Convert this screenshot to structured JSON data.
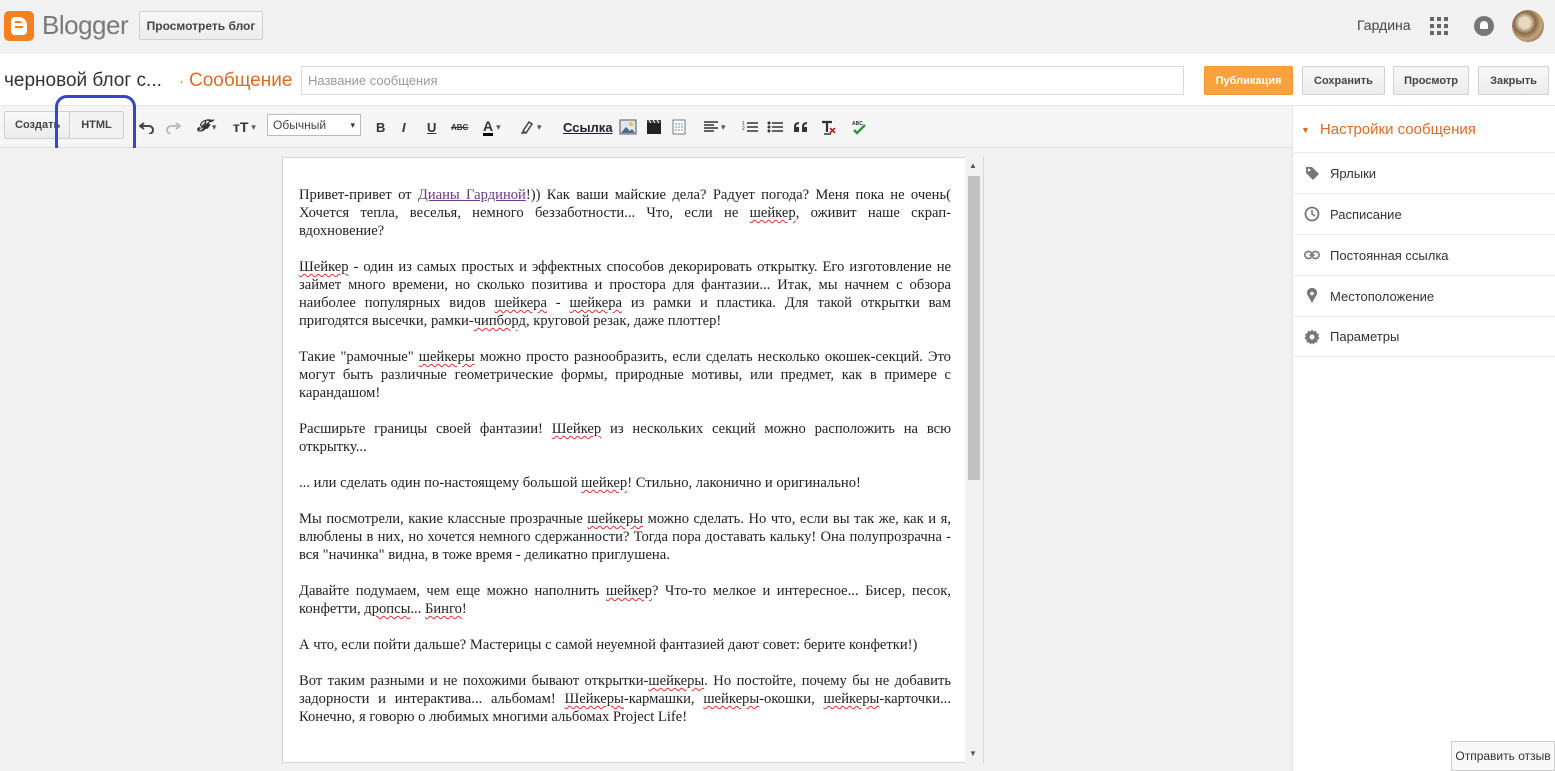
{
  "app": {
    "logo_text": "Blogger",
    "view_blog": "Просмотреть блог",
    "user_name": "Гардина"
  },
  "titlebar": {
    "blog_name": "черновой блог с...",
    "separator": "·",
    "section": "Сообщение",
    "title_placeholder": "Название сообщения",
    "publish": "Публикация",
    "save": "Сохранить",
    "preview": "Просмотр",
    "close": "Закрыть"
  },
  "toolbar": {
    "compose": "Создать",
    "html": "HTML",
    "format": "Обычный",
    "link": "Ссылка",
    "font_icon": "𝓕",
    "size_icon": "тT",
    "bold": "B",
    "italic": "I",
    "underline": "U",
    "strike": "ABC",
    "text_color": "A",
    "caret": "▾"
  },
  "sidebar": {
    "header": "Настройки сообщения",
    "items": [
      {
        "label": "Ярлыки",
        "icon": "label-icon"
      },
      {
        "label": "Расписание",
        "icon": "clock-icon"
      },
      {
        "label": "Постоянная ссылка",
        "icon": "link-icon"
      },
      {
        "label": "Местоположение",
        "icon": "location-icon"
      },
      {
        "label": "Параметры",
        "icon": "gear-icon"
      }
    ]
  },
  "feedback": "Отправить отзыв",
  "post": {
    "p1": {
      "a": "Привет-привет от ",
      "link": "Дианы Гардиной",
      "b": "!)) Как ваши майские дела? Радует погода? Меня пока не очень( Хочется тепла, веселья, немного беззаботности... Что, если не ",
      "w1": "шейкер",
      "c": ", оживит наше скрап-вдохновение?"
    },
    "p2": {
      "w1": "Шейкер",
      "a": " - один из самых простых и эффектных способов декорировать открытку. Его изготовление не займет много времени, но сколько позитива и простора для фантазии... Итак, мы начнем с обзора наиболее популярных видов ",
      "w2": "шейкера",
      "b": " - ",
      "w3": "шейкера",
      "c": " из рамки и пластика. Для такой открытки вам пригодятся высечки, рамки-",
      "w4": "чипборд",
      "d": ", круговой резак, даже плоттер!"
    },
    "p3": {
      "a": "Такие \"рамочные\" ",
      "w1": "шейкеры",
      "b": " можно просто разнообразить, если сделать несколько окошек-секций. Это могут быть различные геометрические формы, природные мотивы, или предмет, как в примере с карандашом!"
    },
    "p4": {
      "a": "Расширьте границы своей фантазии! ",
      "w1": "Шейкер",
      "b": " из нескольких секций можно расположить на всю открытку..."
    },
    "p5": {
      "a": "... или сделать один по-настоящему большой ",
      "w1": "шейкер",
      "b": "! Стильно, лаконично и оригинально!"
    },
    "p6": {
      "a": "Мы посмотрели, какие классные прозрачные ",
      "w1": "шейкеры",
      "b": " можно сделать. Но что, если вы так же, как и я, влюблены в них, но хочется немного сдержанности? Тогда пора доставать кальку! Она полупрозрачна - вся \"начинка\" видна, в тоже время - деликатно приглушена."
    },
    "p7": {
      "a": "Давайте подумаем, чем еще можно наполнить ",
      "w1": "шейкер",
      "b": "? Что-то мелкое и интересное... Бисер, песок, конфетти, ",
      "w2": "дропсы",
      "c": "... ",
      "w3": "Бинго",
      "d": "!"
    },
    "p8": {
      "a": "А что, если пойти дальше? Мастерицы с самой неуемной фантазией дают совет: берите конфетки!)"
    },
    "p9": {
      "a": "Вот таким разными и не похожими бывают открытки-",
      "w1": "шейкеры",
      "b": ". Но постойте, почему бы не добавить задорности и интерактива... альбомам! ",
      "w2": "Шейкеры",
      "c": "-кармашки, ",
      "w3": "шейкеры",
      "d": "-окошки, ",
      "w4": "шейкеры",
      "e": "-карточки... Конечно, я говорю о любимых многими альбомах Project Life!"
    }
  }
}
